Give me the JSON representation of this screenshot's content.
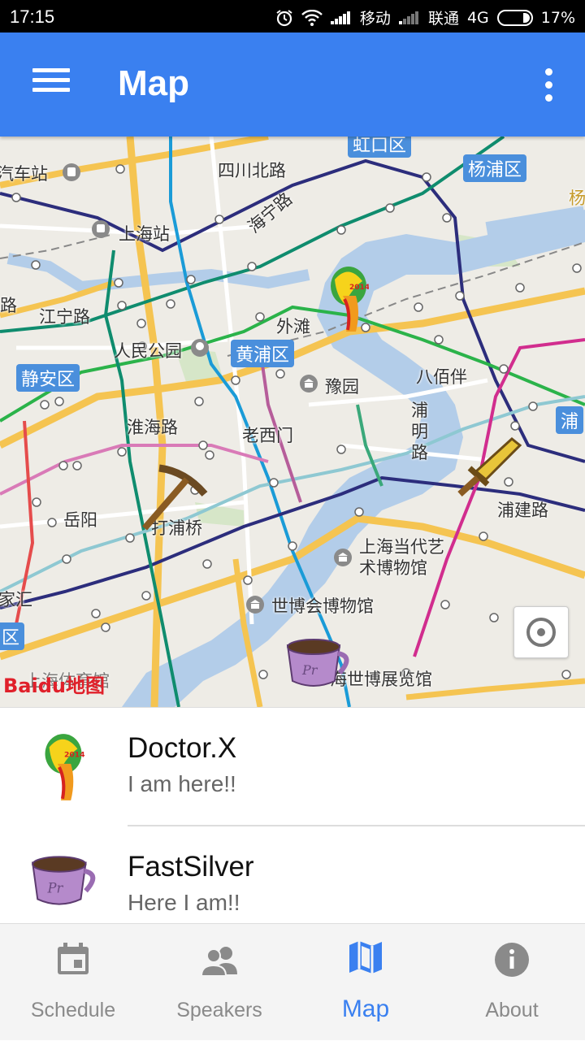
{
  "status_bar": {
    "time": "17:15",
    "carrier1": "移动",
    "carrier2": "联通",
    "network": "4G",
    "battery": "17%"
  },
  "app_bar": {
    "title": "Map",
    "menu_icon": "hamburger-menu-icon",
    "more_icon": "more-vert-icon"
  },
  "map": {
    "labels": {
      "bus_station": "汽车站",
      "sichuan_rd": "四川北路",
      "hongkou": "虹口区",
      "yangpu": "杨浦区",
      "yang": "杨",
      "shanghai_station": "上海站",
      "haining_rd": "海宁路",
      "lu": "路",
      "jiangning_rd": "江宁路",
      "waitan": "外滩",
      "renmin_park": "人民公园",
      "huangpu": "黄浦区",
      "yuyuan": "豫园",
      "bapuban": "八佰伴",
      "jingan": "静安区",
      "pu": "浦",
      "huaihai_rd": "淮海路",
      "laoximen": "老西门",
      "puming_rd": "浦明路",
      "dapuqiao": "打浦桥",
      "pujian_rd": "浦建路",
      "yueyang": "岳阳",
      "power_station": "上海当代艺术博物馆",
      "xuhui": "家汇",
      "district_left": "区",
      "expo_museum": "世博会博物馆",
      "expo_center": "海世博展览馆",
      "stadium": "上海体育馆"
    },
    "logo": "Baidu地图",
    "locate_icon": "my-location-icon"
  },
  "list": [
    {
      "name": "Doctor.X",
      "message": "I am here!!",
      "avatar": "worldcup-trophy-icon"
    },
    {
      "name": "FastSilver",
      "message": "Here I am!!",
      "avatar": "coffee-cup-icon"
    }
  ],
  "bottom_nav": [
    {
      "label": "Schedule",
      "icon": "calendar-icon",
      "active": false
    },
    {
      "label": "Speakers",
      "icon": "people-icon",
      "active": false
    },
    {
      "label": "Map",
      "icon": "map-icon",
      "active": true
    },
    {
      "label": "About",
      "icon": "info-icon",
      "active": false
    }
  ],
  "colors": {
    "primary": "#3a80f0",
    "map_water": "#b3cde9",
    "map_district_tag": "#4a8fdc"
  }
}
